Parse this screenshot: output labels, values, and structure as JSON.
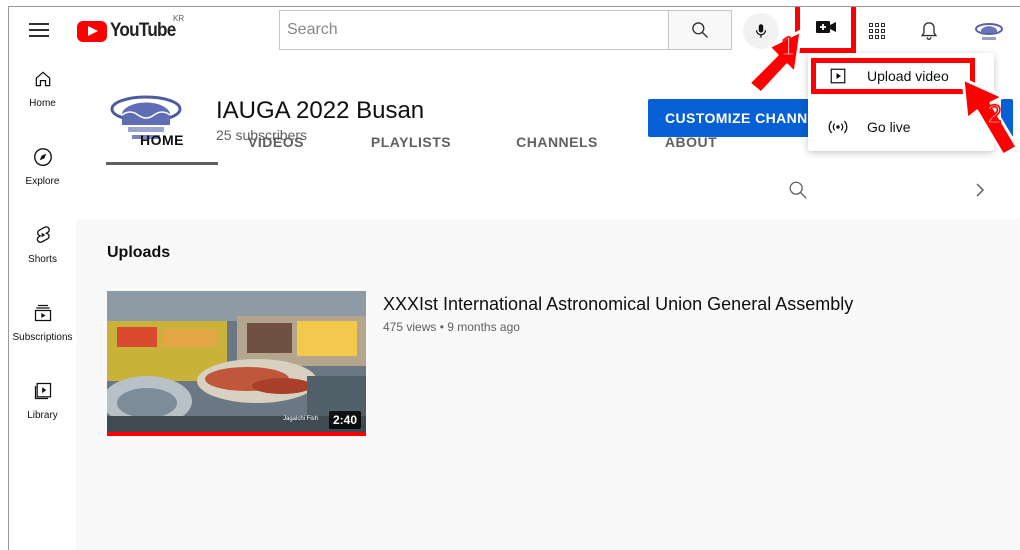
{
  "header": {
    "logo_text": "YouTube",
    "country_code": "KR",
    "search_placeholder": "Search"
  },
  "sidebar": {
    "items": [
      {
        "label": "Home",
        "icon": "home-icon"
      },
      {
        "label": "Explore",
        "icon": "compass-icon"
      },
      {
        "label": "Shorts",
        "icon": "shorts-icon"
      },
      {
        "label": "Subscriptions",
        "icon": "subscriptions-icon"
      },
      {
        "label": "Library",
        "icon": "library-icon"
      }
    ]
  },
  "channel": {
    "name": "IAUGA 2022 Busan",
    "subscribers": "25 subscribers",
    "customize_label": "CUSTOMIZE CHANNEL"
  },
  "tabs": [
    "HOME",
    "VIDEOS",
    "PLAYLISTS",
    "CHANNELS",
    "ABOUT"
  ],
  "content": {
    "section_title": "Uploads",
    "video": {
      "title": "XXXIst International Astronomical Union General Assembly",
      "meta": "475 views • 9 months ago",
      "duration": "2:40",
      "thumb_caption": "Jagalchi Fish"
    }
  },
  "create_menu": {
    "items": [
      {
        "label": "Upload video",
        "icon": "upload-video-icon"
      },
      {
        "label": "Go live",
        "icon": "live-icon"
      }
    ]
  },
  "annotations": {
    "step1": "1",
    "step2": "2",
    "color": "#ff0000"
  },
  "colors": {
    "brand_red": "#ff0000",
    "accent_blue": "#065fd4"
  }
}
